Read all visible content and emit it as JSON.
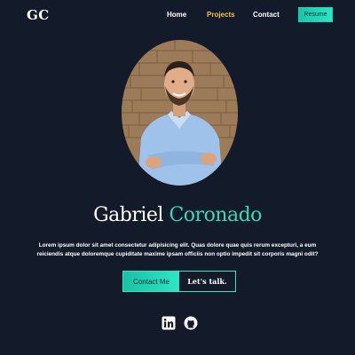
{
  "nav": {
    "logo": "GC",
    "links": [
      "Home",
      "Projects",
      "Contact"
    ],
    "active_link": "Projects",
    "resume_label": "Resume"
  },
  "hero": {
    "first_name": "Gabriel",
    "last_name": "Coronado",
    "bio": "Lorem ipsum dolor sit amet consectetur adipisicing elit. Quas dolore quae quis rerum excepturi, a eum reiciendis atque doloremque cupiditate maxime ipsam officiis non optio impedit sit corporis magni odit?",
    "contact_label": "Contact Me",
    "talk_label": "Let's talk."
  },
  "social": {
    "icons": [
      "linkedin-icon",
      "github-icon"
    ]
  },
  "colors": {
    "background": "#131a2a",
    "accent": "#38d9b6",
    "active_nav": "#f4c24d"
  }
}
